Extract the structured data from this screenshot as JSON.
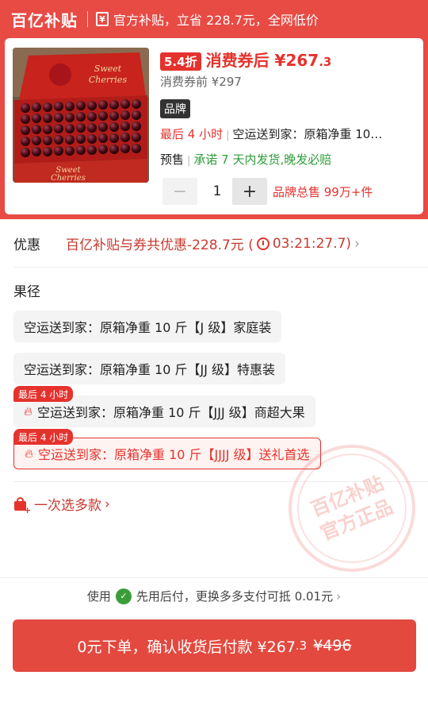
{
  "topbar": {
    "brand": "百亿补贴",
    "subsidy_text": "官方补贴，立省 228.7元，全网低价"
  },
  "product": {
    "discount_badge": "5.4折",
    "after_coupon_label": "消费券后 ¥267",
    "after_coupon_decimal": ".3",
    "before_coupon": "消费券前 ¥297",
    "brand_tag": "品牌",
    "selected_hours": "最后 4 小时",
    "selected_spec": "空运送到家：原箱净重 10…",
    "presale_label": "预售",
    "presale_promise": "承诺 7 天内发货,晚发必赔",
    "quantity_minus": "−",
    "quantity": "1",
    "quantity_plus": "+",
    "sales": "品牌总售 99万+件",
    "image_text_top": "Sweet",
    "image_text_top2": "Cherries",
    "image_text_bottom": "Sweet",
    "image_text_bottom2": "Cherries"
  },
  "promotion": {
    "label": "优惠",
    "text": "百亿补贴与券共优惠-228.7元 (",
    "countdown": "03:21:27.7",
    "close": ")",
    "chevron": "›"
  },
  "spec": {
    "title": "果径",
    "options": [
      {
        "label": "空运送到家：原箱净重 10 斤【J 级】家庭装",
        "tag": ""
      },
      {
        "label": "空运送到家：原箱净重 10 斤【JJ 级】特惠装",
        "tag": ""
      },
      {
        "label": "空运送到家：原箱净重 10 斤【JJJ 级】商超大果",
        "tag": "最后 4 小时"
      },
      {
        "label": "空运送到家：原箱净重 10 斤【JJJJ 级】送礼首选",
        "tag": "最后 4 小时"
      }
    ]
  },
  "multi_select": {
    "label": "一次选多款",
    "chevron": "›"
  },
  "stamp": {
    "line1": "百亿补贴",
    "line2": "官方正品"
  },
  "payment": {
    "prefix": "使用",
    "text": "先用后付，更换多多支付可抵 0.01元",
    "chevron": "›"
  },
  "order_button": {
    "main": "0元下单，确认收货后付款 ¥267",
    "decimal": ".3",
    "original": "¥496"
  },
  "colors": {
    "accent": "#e5322d",
    "header": "#e84a44",
    "green": "#2e9e3a"
  }
}
